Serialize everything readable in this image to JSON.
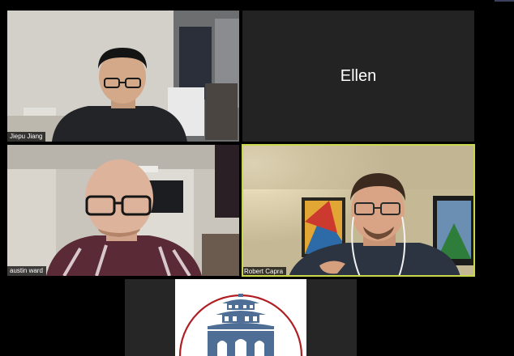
{
  "meeting": {
    "participants": [
      {
        "id": "jiepu",
        "name": "Jiepu Jiang",
        "video_on": true
      },
      {
        "id": "ellen",
        "name": "Ellen",
        "video_on": false
      },
      {
        "id": "austin",
        "name": "austin ward",
        "video_on": true
      },
      {
        "id": "robert",
        "name": "Robert Capra",
        "video_on": true,
        "active_speaker": true
      }
    ],
    "screen_share": {
      "content": "logo-pagoda-arch"
    }
  },
  "colors": {
    "background": "#000000",
    "tile_empty": "#232323",
    "active_speaker_border": "#c9d84a",
    "name_tag_bg": "rgba(0,0,0,0.72)",
    "logo_blue": "#4f6e95",
    "logo_arc_red": "#b01e23"
  }
}
